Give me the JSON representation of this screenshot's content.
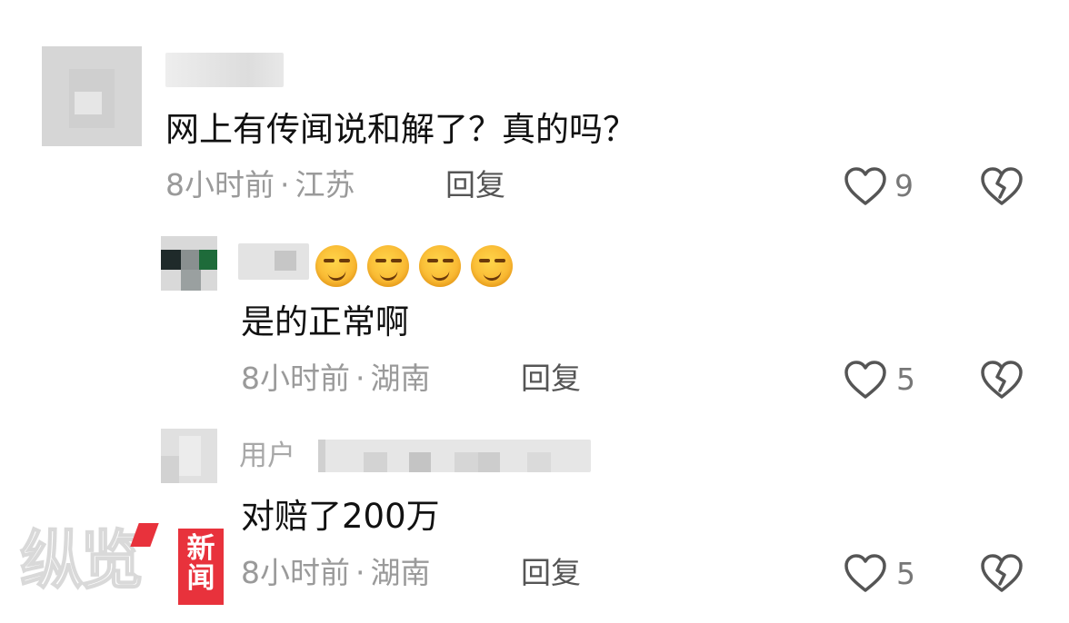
{
  "comments": [
    {
      "text": "网上有传闻说和解了？真的吗？",
      "time": "8小时前",
      "location": "江苏",
      "reply_label": "回复",
      "likes": "9"
    },
    {
      "text": "是的正常啊",
      "time": "8小时前",
      "location": "湖南",
      "reply_label": "回复",
      "likes": "5"
    },
    {
      "user_prefix": "用户",
      "text": "对赔了200万",
      "time": "8小时前",
      "location": "湖南",
      "reply_label": "回复",
      "likes": "5"
    }
  ],
  "separator": "·",
  "watermark": {
    "logo_text": "纵览",
    "badge_line1": "新",
    "badge_line2": "闻"
  },
  "colors": {
    "meta_gray": "#9a9a9a",
    "badge_red": "#e8323c"
  },
  "icons": [
    "heart-outline-icon",
    "broken-heart-icon",
    "smirk-emoji"
  ]
}
